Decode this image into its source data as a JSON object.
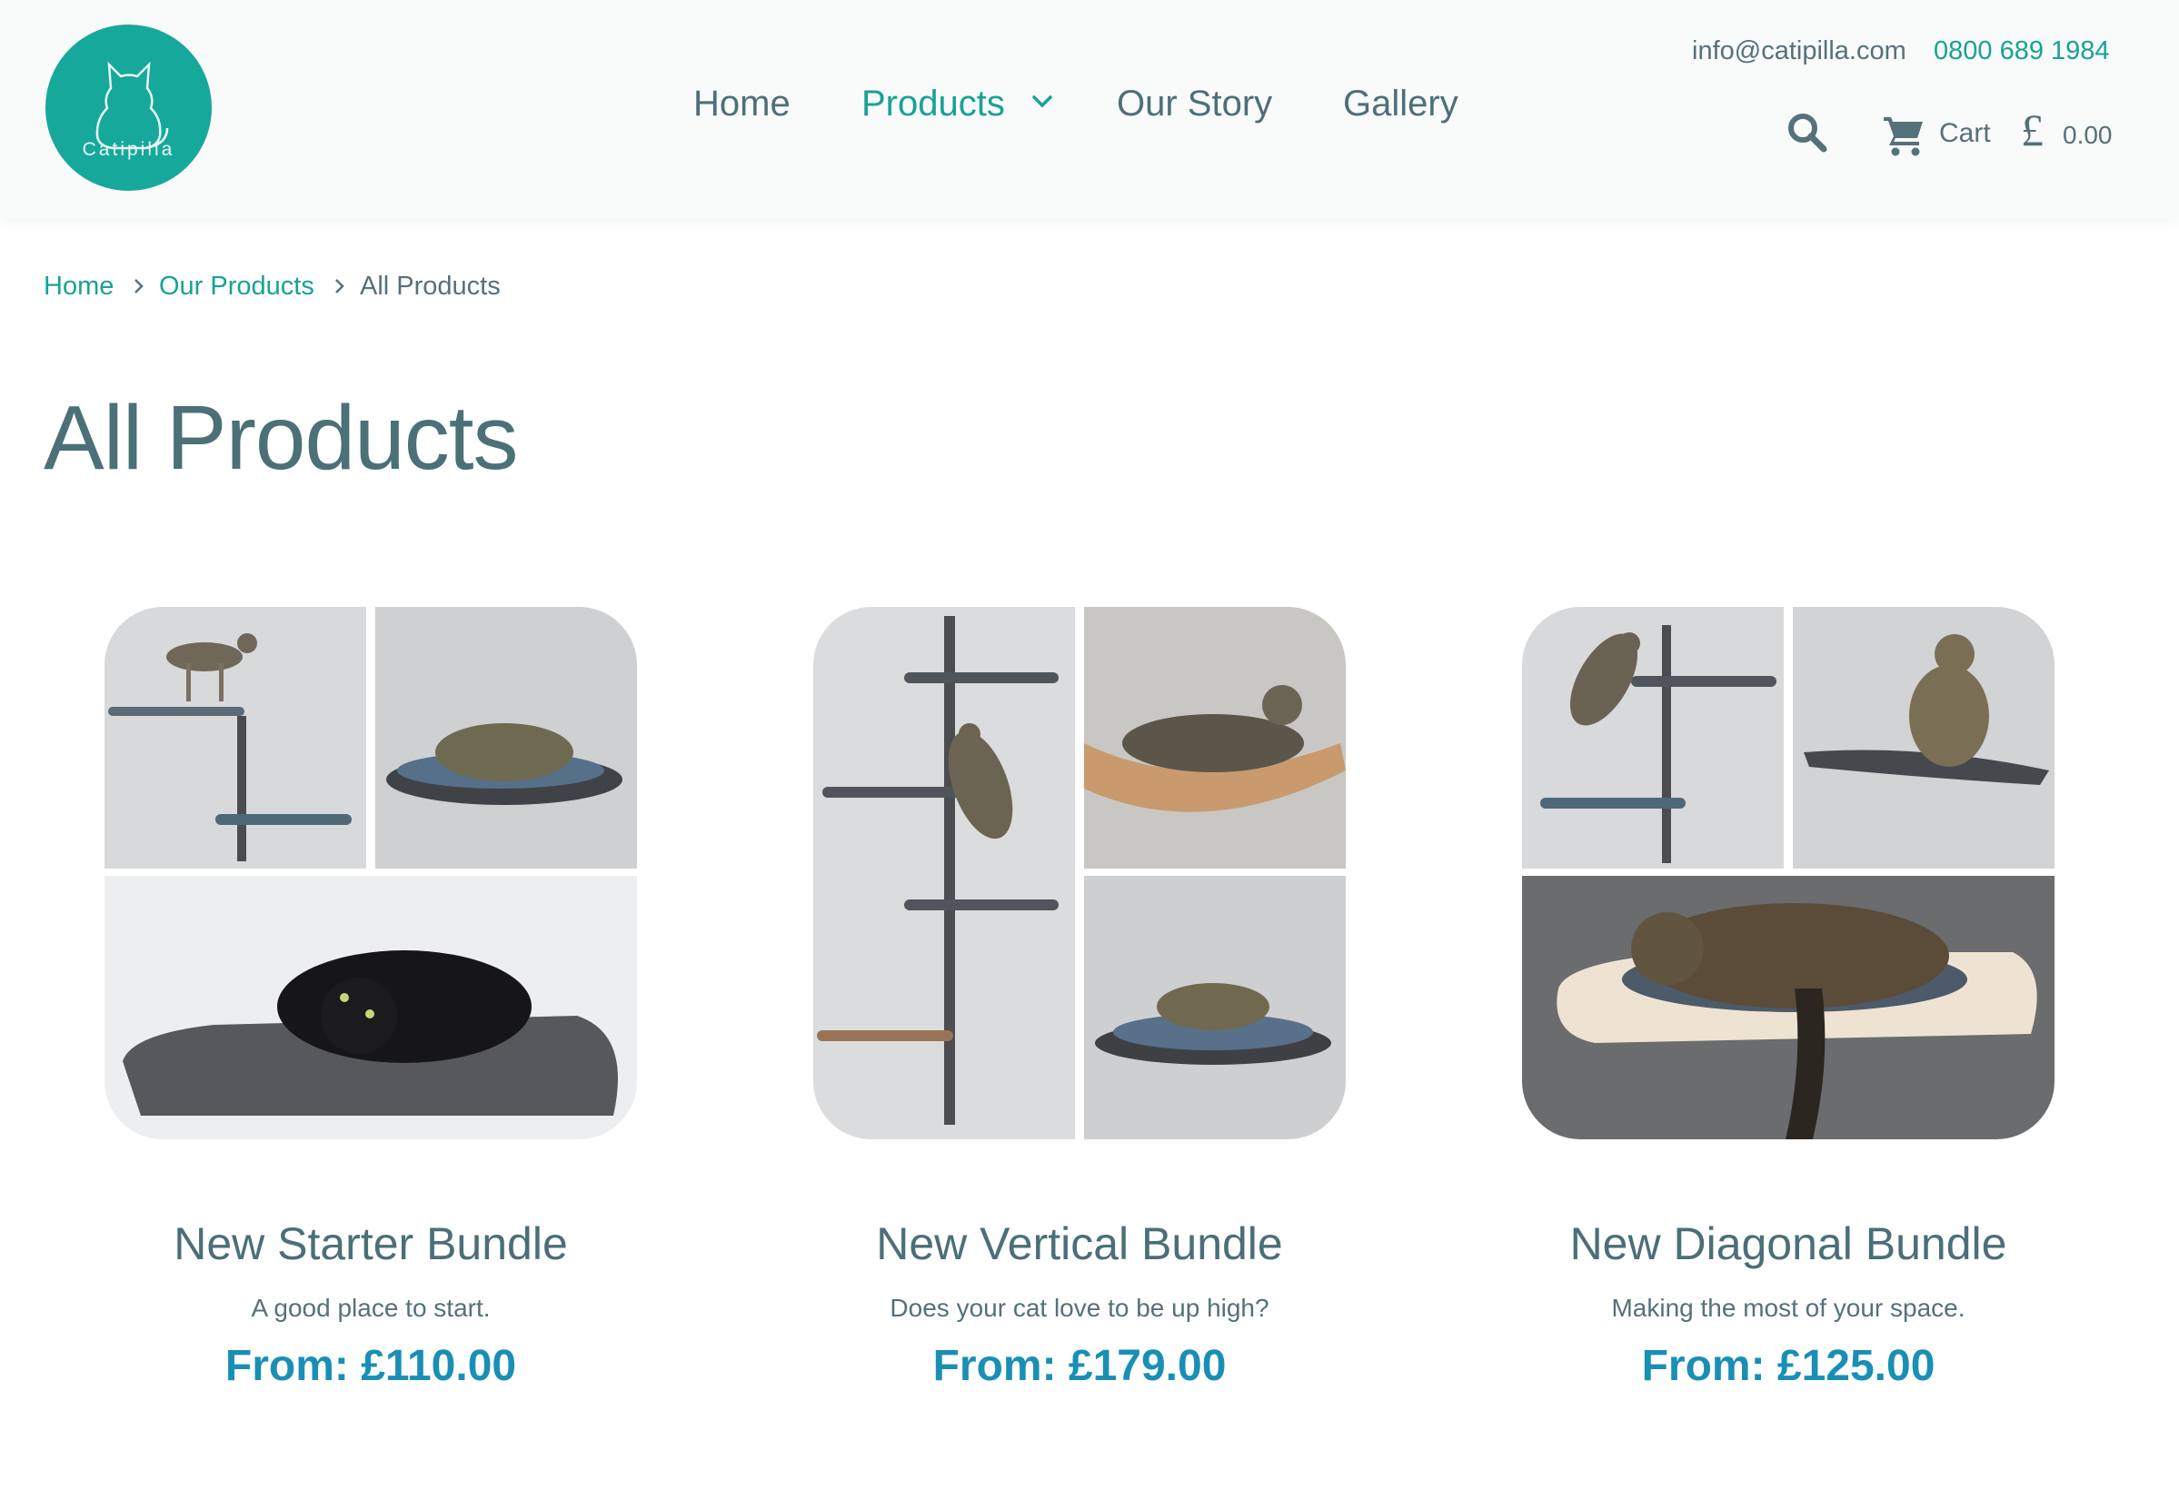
{
  "brand": {
    "name": "Catipilla",
    "color": "#17a89c"
  },
  "nav": {
    "items": [
      {
        "label": "Home"
      },
      {
        "label": "Products"
      },
      {
        "label": "Our Story"
      },
      {
        "label": "Gallery"
      }
    ]
  },
  "contact": {
    "email": "info@catipilla.com",
    "phone": "0800 689 1984"
  },
  "cart": {
    "label": "Cart",
    "currency": "£",
    "total": "0.00"
  },
  "breadcrumb": [
    {
      "label": "Home"
    },
    {
      "label": "Our Products"
    },
    {
      "label": "All Products"
    }
  ],
  "page": {
    "title": "All Products"
  },
  "products": [
    {
      "name": "New Starter Bundle",
      "tagline": "A good place to start.",
      "price": "From: £110.00"
    },
    {
      "name": "New Vertical Bundle",
      "tagline": "Does your cat love to be up high?",
      "price": "From: £179.00"
    },
    {
      "name": "New Diagonal Bundle",
      "tagline": "Making the most of your space.",
      "price": "From: £125.00"
    }
  ],
  "colors": {
    "accent": "#18a295",
    "price": "#1a8fb5",
    "text": "#4b6f78"
  }
}
